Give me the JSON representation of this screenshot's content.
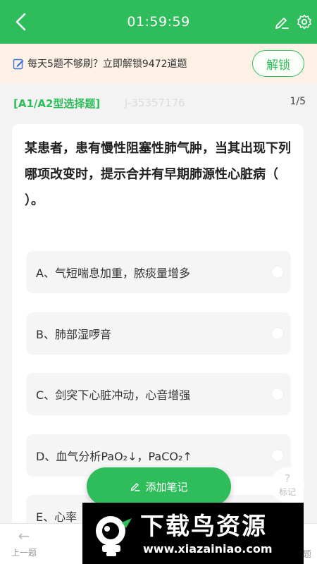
{
  "header": {
    "timer": "01:59:59"
  },
  "promo": {
    "text": "每天5题不够刷？立即解锁9472道题",
    "unlock_label": "解锁"
  },
  "question": {
    "type_label": "[A1/A2型选择题]",
    "id": "J-35357176",
    "progress": "1/5",
    "stem": "某患者，患有慢性阻塞性肺气肿，当其出现下列哪项改变时，提示合并有早期肺源性心脏病（ ）。",
    "options": [
      {
        "prefix": "A、",
        "text": "气短喘息加重，脓痰量增多"
      },
      {
        "prefix": "B、",
        "text": "肺部湿啰音"
      },
      {
        "prefix": "C、",
        "text": "剑突下心脏冲动，心音增强"
      },
      {
        "prefix": "D、",
        "text": "血气分析PaO₂↓，PaCO₂↑"
      },
      {
        "prefix": "E、",
        "text": "心率"
      }
    ]
  },
  "actions": {
    "add_note_label": "添加笔记",
    "mark_label": "标记"
  },
  "bottom_nav": {
    "prev_label": "上一题",
    "answer_label": "题"
  },
  "watermark": {
    "title": "下载鸟资源",
    "url": "www.xiazainiao.com"
  },
  "colors": {
    "brand_green": "#2fbd5b",
    "promo_bg": "#fdf1e6"
  }
}
